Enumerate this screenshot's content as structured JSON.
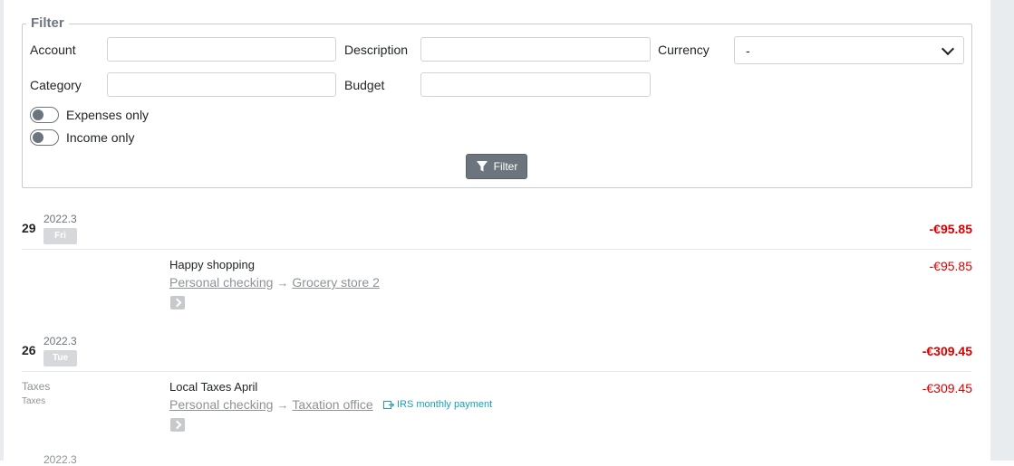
{
  "filter": {
    "legend": "Filter",
    "account_label": "Account",
    "description_label": "Description",
    "currency_label": "Currency",
    "currency_value": "-",
    "category_label": "Category",
    "budget_label": "Budget",
    "expenses_only_label": "Expenses only",
    "income_only_label": "Income only",
    "expenses_only_on": false,
    "income_only_on": false,
    "button_label": "Filter"
  },
  "days": [
    {
      "day": "29",
      "year_month": "2022.3",
      "weekday": "Fri",
      "total": "-€95.85",
      "transactions": [
        {
          "description": "Happy shopping",
          "source": "Personal checking",
          "destination": "Grocery store 2",
          "amount": "-€95.85",
          "category": "",
          "subcategory": "",
          "recurring": ""
        }
      ]
    },
    {
      "day": "26",
      "year_month": "2022.3",
      "weekday": "Tue",
      "total": "-€309.45",
      "transactions": [
        {
          "description": "Local Taxes April",
          "source": "Personal checking",
          "destination": "Taxation office",
          "amount": "-€309.45",
          "category": "Taxes",
          "subcategory": "Taxes",
          "recurring": "IRS monthly payment"
        }
      ]
    }
  ],
  "next_day_partial": "2022.3",
  "colors": {
    "negative": "#dc0000",
    "muted": "#8e9397",
    "recurring": "#17a2b8",
    "button": "#6c757d"
  }
}
